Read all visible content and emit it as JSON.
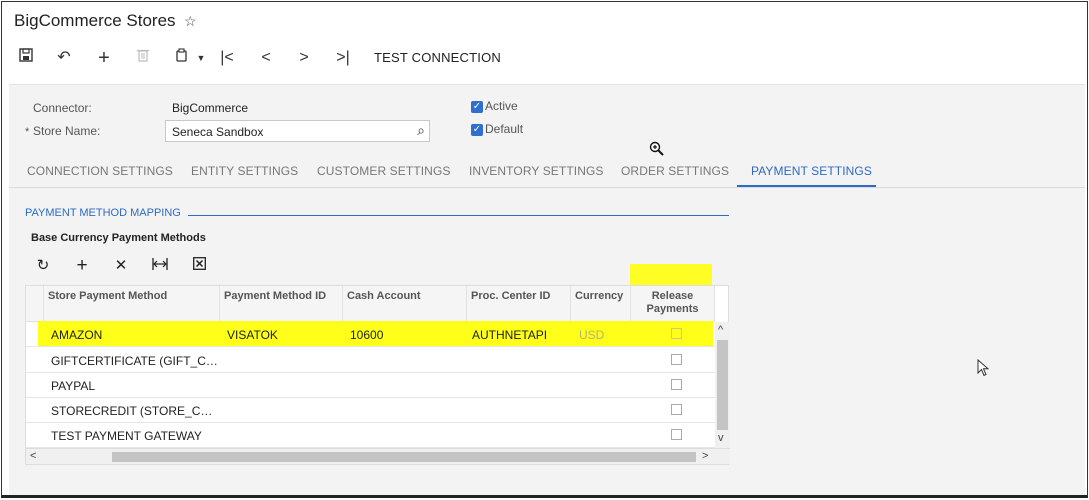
{
  "page": {
    "title": "BigCommerce Stores",
    "favorite_icon": "star-outline-icon"
  },
  "toolbar": {
    "test_connection": "TEST CONNECTION"
  },
  "form": {
    "connector_label": "Connector:",
    "connector_value": "BigCommerce",
    "store_name_label": "Store Name:",
    "required_mark": "*",
    "store_name_value": "Seneca Sandbox",
    "active_label": "Active",
    "default_label": "Default",
    "active_checked": true,
    "default_checked": true
  },
  "tabs": [
    {
      "label": "CONNECTION SETTINGS",
      "active": false
    },
    {
      "label": "ENTITY SETTINGS",
      "active": false
    },
    {
      "label": "CUSTOMER SETTINGS",
      "active": false
    },
    {
      "label": "INVENTORY SETTINGS",
      "active": false
    },
    {
      "label": "ORDER SETTINGS",
      "active": false
    },
    {
      "label": "PAYMENT SETTINGS",
      "active": true
    }
  ],
  "section": {
    "title": "PAYMENT METHOD MAPPING",
    "subtitle": "Base Currency Payment Methods"
  },
  "grid": {
    "columns": [
      "Store Payment Method",
      "Payment Method ID",
      "Cash Account",
      "Proc. Center ID",
      "Currency",
      "Release Payments"
    ],
    "rows": [
      {
        "store_payment_method": "AMAZON",
        "payment_method_id": "VISATOK",
        "cash_account": "10600",
        "proc_center_id": "AUTHNETAPI",
        "currency": "USD",
        "release": false
      },
      {
        "store_payment_method": "GIFTCERTIFICATE (GIFT_C…",
        "payment_method_id": "",
        "cash_account": "",
        "proc_center_id": "",
        "currency": "",
        "release": false
      },
      {
        "store_payment_method": "PAYPAL",
        "payment_method_id": "",
        "cash_account": "",
        "proc_center_id": "",
        "currency": "",
        "release": false
      },
      {
        "store_payment_method": "STORECREDIT (STORE_C…",
        "payment_method_id": "",
        "cash_account": "",
        "proc_center_id": "",
        "currency": "",
        "release": false
      },
      {
        "store_payment_method": "TEST PAYMENT GATEWAY",
        "payment_method_id": "",
        "cash_account": "",
        "proc_center_id": "",
        "currency": "",
        "release": false
      }
    ]
  },
  "colors": {
    "accent": "#2d6bc4",
    "highlight": "#ffff00"
  }
}
